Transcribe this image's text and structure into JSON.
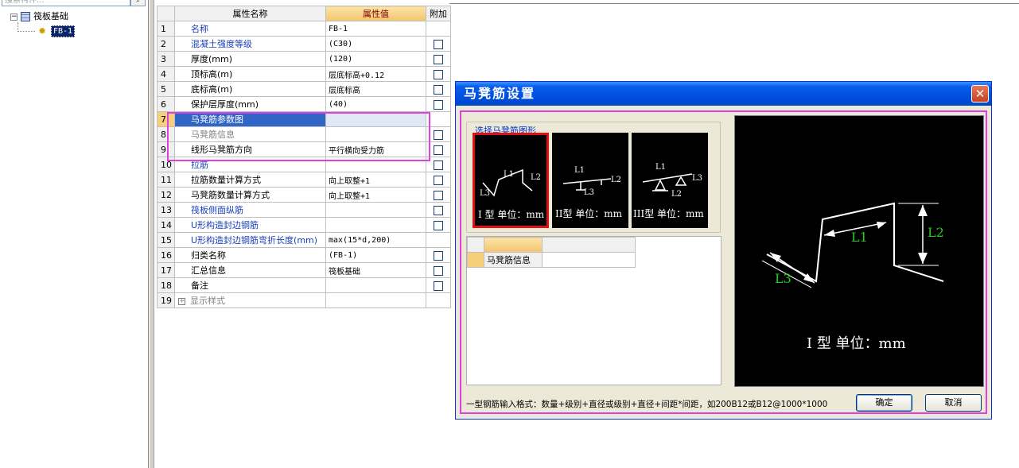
{
  "tree": {
    "search_placeholder": "搜索构件...",
    "root_label": "筏板基础",
    "selected_label": "FB-1"
  },
  "grid": {
    "headers": {
      "name": "属性名称",
      "value": "属性值",
      "extra": "附加"
    },
    "rows": [
      {
        "num": "1",
        "name": "名称",
        "value": "FB-1",
        "style": "blue",
        "check": false
      },
      {
        "num": "2",
        "name": "混凝土强度等级",
        "value": "(C30)",
        "style": "blue",
        "check": true
      },
      {
        "num": "3",
        "name": "厚度(mm)",
        "value": "(120)",
        "style": "normal",
        "check": true
      },
      {
        "num": "4",
        "name": "顶标高(m)",
        "value": "层底标高+0.12",
        "style": "normal",
        "check": true
      },
      {
        "num": "5",
        "name": "底标高(m)",
        "value": "层底标高",
        "style": "normal",
        "check": true
      },
      {
        "num": "6",
        "name": "保护层厚度(mm)",
        "value": "(40)",
        "style": "normal",
        "check": true
      },
      {
        "num": "7",
        "name": "马凳筋参数图",
        "value": "",
        "style": "selected",
        "check": false
      },
      {
        "num": "8",
        "name": "马凳筋信息",
        "value": "",
        "style": "gray",
        "check": true
      },
      {
        "num": "9",
        "name": "线形马凳筋方向",
        "value": "平行横向受力筋",
        "style": "normal",
        "check": true
      },
      {
        "num": "10",
        "name": "拉筋",
        "value": "",
        "style": "blue",
        "check": true
      },
      {
        "num": "11",
        "name": "拉筋数量计算方式",
        "value": "向上取整+1",
        "style": "normal",
        "check": true
      },
      {
        "num": "12",
        "name": "马凳筋数量计算方式",
        "value": "向上取整+1",
        "style": "normal",
        "check": true
      },
      {
        "num": "13",
        "name": "筏板侧面纵筋",
        "value": "",
        "style": "blue",
        "check": true
      },
      {
        "num": "14",
        "name": "U形构造封边钢筋",
        "value": "",
        "style": "blue",
        "check": true
      },
      {
        "num": "15",
        "name": "U形构造封边钢筋弯折长度(mm)",
        "value": "max(15*d,200)",
        "style": "blue",
        "check": false
      },
      {
        "num": "16",
        "name": "归类名称",
        "value": "(FB-1)",
        "style": "normal",
        "check": true
      },
      {
        "num": "17",
        "name": "汇总信息",
        "value": "筏板基础",
        "style": "normal",
        "check": true
      },
      {
        "num": "18",
        "name": "备注",
        "value": "",
        "style": "normal",
        "check": true
      },
      {
        "num": "19",
        "name": "显示样式",
        "value": "",
        "style": "gray-expand",
        "check": false
      }
    ]
  },
  "dialog": {
    "title": "马凳筋设置",
    "close_symbol": "✕",
    "group_title": "选择马凳筋图形",
    "thumbs": [
      {
        "caption": "I 型 单位：mm",
        "labels": [
          "L1",
          "L2",
          "L3"
        ]
      },
      {
        "caption": "II型 单位：mm",
        "labels": [
          "L1",
          "L2",
          "L3"
        ]
      },
      {
        "caption": "III型 单位：mm",
        "labels": [
          "L1",
          "L3",
          "L2"
        ]
      }
    ],
    "info_row_label": "马凳筋信息",
    "preview": {
      "l1": "L1",
      "l2": "L2",
      "l3": "L3",
      "caption": "I 型  单位：mm"
    },
    "hint": "一型钢筋输入格式：数量+级别+直径或级别+直径+间距*间距，如200B12或B12@1000*1000",
    "ok_label": "确定",
    "cancel_label": "取消"
  },
  "colors": {
    "magenta": "#e040e0",
    "link_blue": "#1a3fb8",
    "selection": "#3166c6",
    "green_label": "#22cc22"
  }
}
